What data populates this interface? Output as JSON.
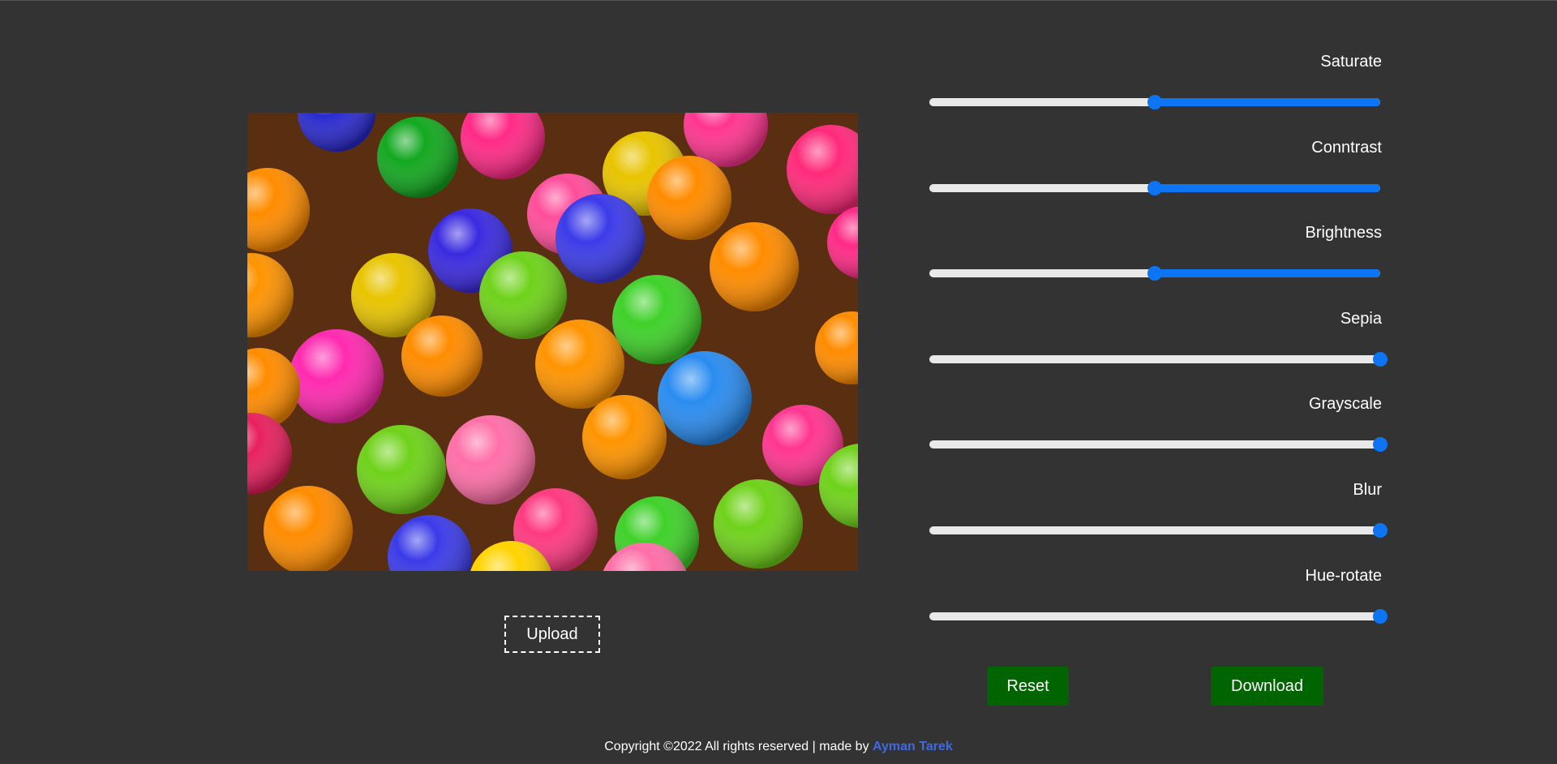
{
  "preview": {
    "alt": "colorful plastic balls"
  },
  "upload": {
    "label": "Upload"
  },
  "filters": [
    {
      "label": "Saturate",
      "value": 0.5
    },
    {
      "label": "Conntrast",
      "value": 0.5
    },
    {
      "label": "Brightness",
      "value": 0.5
    },
    {
      "label": "Sepia",
      "value": 1.0
    },
    {
      "label": "Grayscale",
      "value": 1.0
    },
    {
      "label": "Blur",
      "value": 1.0
    },
    {
      "label": "Hue-rotate",
      "value": 1.0
    }
  ],
  "actions": {
    "reset_label": "Reset",
    "download_label": "Download"
  },
  "footer": {
    "text": "Copyright ©2022 All rights reserved | made by ",
    "author": "Ayman Tarek"
  },
  "colors": {
    "background": "#333333",
    "accent": "#0d74f3",
    "button": "#006400",
    "link": "#4169e1"
  }
}
